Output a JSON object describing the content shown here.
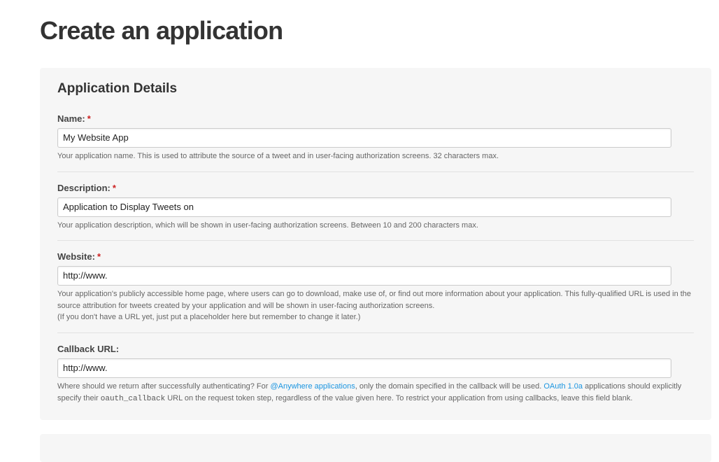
{
  "page": {
    "title": "Create an application"
  },
  "details": {
    "section_title": "Application Details",
    "required_marker": "*",
    "name": {
      "label": "Name:",
      "value": "My Website App",
      "help": "Your application name. This is used to attribute the source of a tweet and in user-facing authorization screens. 32 characters max."
    },
    "description": {
      "label": "Description:",
      "value": "Application to Display Tweets on",
      "help": "Your application description, which will be shown in user-facing authorization screens. Between 10 and 200 characters max."
    },
    "website": {
      "label": "Website:",
      "value": "http://www.",
      "help_line1": "Your application's publicly accessible home page, where users can go to download, make use of, or find out more information about your application. This fully-qualified URL is used in the source attribution for tweets created by your application and will be shown in user-facing authorization screens.",
      "help_line2": "(If you don't have a URL yet, just put a placeholder here but remember to change it later.)"
    },
    "callback": {
      "label": "Callback URL:",
      "value": "http://www.",
      "help_part1": "Where should we return after successfully authenticating? For ",
      "help_link1": "@Anywhere applications",
      "help_part2": ", only the domain specified in the callback will be used. ",
      "help_link2": "OAuth 1.0a",
      "help_part3": " applications should explicitly specify their ",
      "help_code": "oauth_callback",
      "help_part4": " URL on the request token step, regardless of the value given here. To restrict your application from using callbacks, leave this field blank."
    }
  }
}
